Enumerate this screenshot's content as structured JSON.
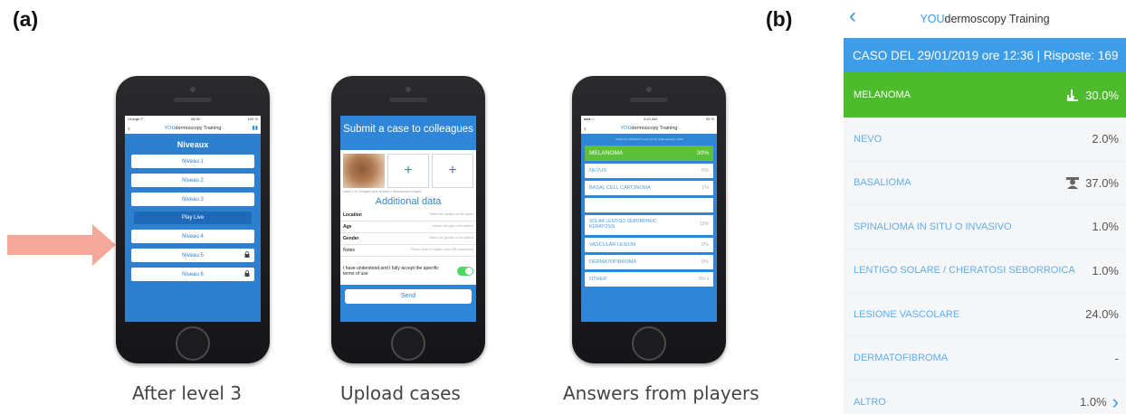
{
  "labels": {
    "panel_a": "(a)",
    "panel_b": "(b)"
  },
  "colors": {
    "blue": "#2f86d6",
    "green": "#4cbb2c",
    "arrow": "#f4a89a"
  },
  "phone1": {
    "status_left": "Orange F",
    "status_time": "08:55",
    "status_right": "100 %",
    "brand_prefix": "YOU",
    "brand_suffix": "dermoscopy Training",
    "title": "Niveaux",
    "levels": [
      "Niveau 1",
      "Niveau 2",
      "Niveau 3",
      "Play Live",
      "Niveau 4",
      "Niveau 5",
      "Niveau 6"
    ],
    "caption": "After level 3"
  },
  "phone2": {
    "header": "Submit a case to colleagues",
    "plus": "+",
    "image_note": "Insert 1 to 3 images (one at least 1 dermoscopic image)",
    "additional": "Additional data",
    "fields": [
      {
        "label": "Location",
        "placeholder": "Select the location of the lesion"
      },
      {
        "label": "Age",
        "placeholder": "Indicate the age of the patient"
      },
      {
        "label": "Gender",
        "placeholder": "Select the gender of the patient"
      },
      {
        "label": "Notes",
        "placeholder": "Please write in English (max 255 characters)"
      }
    ],
    "terms": "I have understood and I fully accept the apecific terms of use",
    "send": "Send",
    "caption": "Upload cases"
  },
  "phone3": {
    "status_time": "9:41 AM",
    "status_right": "95 %",
    "brand_prefix": "YOU",
    "brand_suffix": "dermoscopy Training",
    "caso": "CASE OF 27/10/2017 hours 19:31 | Total answers: 1236",
    "answers": [
      {
        "label": "MELANOMA",
        "pct": "30%"
      },
      {
        "label": "NEVUS",
        "pct": "6%"
      },
      {
        "label": "BASAL CELL CARCINOMA",
        "pct": "1%"
      },
      {
        "label": "",
        "pct": ""
      },
      {
        "label": "SOLAR LENTIGO SEBORRHEIC KERATOSIS",
        "pct": "15%"
      },
      {
        "label": "VASCULAR LESION",
        "pct": "0%"
      },
      {
        "label": "DERMATOFIBROMA",
        "pct": "0%"
      },
      {
        "label": "OTHER",
        "pct": "3%"
      }
    ],
    "caption": "Answers from players"
  },
  "panel_b": {
    "brand_prefix": "YOU",
    "brand_suffix": "dermoscopy Training",
    "caso": "CASO DEL 29/01/2019 ore 12:36 | Risposte: 169",
    "rows": [
      {
        "label": "MELANOMA",
        "pct": "30.0%"
      },
      {
        "label": "NEVO",
        "pct": "2.0%"
      },
      {
        "label": "BASALIOMA",
        "pct": "37.0%"
      },
      {
        "label": "SPINALIOMA IN SITU O INVASIVO",
        "pct": "1.0%"
      },
      {
        "label": "LENTIGO SOLARE / CHERATOSI SEBORROICA",
        "pct": "1.0%"
      },
      {
        "label": "LESIONE VASCOLARE",
        "pct": "24.0%"
      },
      {
        "label": "DERMATOFIBROMA",
        "pct": "-"
      },
      {
        "label": "ALTRO",
        "pct": "1.0%"
      }
    ]
  }
}
